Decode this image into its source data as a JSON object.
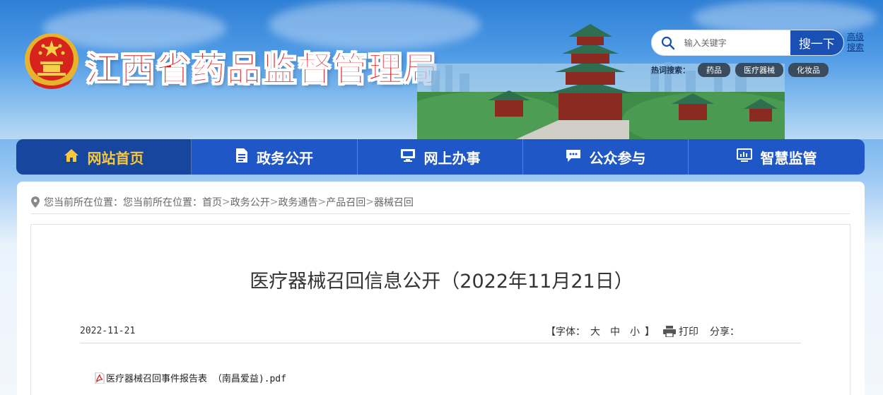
{
  "header": {
    "site_title": "江西省药品监督管理局",
    "emblem_icon": "national-emblem-icon"
  },
  "search": {
    "placeholder": "输入关键字",
    "button_label": "搜一下",
    "advanced_label": "高级搜索",
    "hot_label": "热词搜索：",
    "hot_tags": [
      "药品",
      "医疗器械",
      "化妆品"
    ]
  },
  "nav": {
    "items": [
      {
        "label": "网站首页",
        "icon": "home-icon",
        "active": true
      },
      {
        "label": "政务公开",
        "icon": "document-icon"
      },
      {
        "label": "网上办事",
        "icon": "monitor-icon"
      },
      {
        "label": "公众参与",
        "icon": "chat-icon"
      },
      {
        "label": "智慧监管",
        "icon": "chart-screen-icon"
      }
    ]
  },
  "breadcrumb": {
    "prefix": "您当前所在位置：",
    "prefix2": "您当前所在位置：",
    "items": [
      "首页",
      "政务公开",
      "政务通告",
      "产品召回",
      "器械召回"
    ],
    "separator": ">"
  },
  "article": {
    "title": "医疗器械召回信息公开（2022年11月21日）",
    "date": "2022-11-21",
    "font_label": "【字体：",
    "font_sizes": [
      "大",
      "中",
      "小"
    ],
    "font_close": "】",
    "print_label": "打印",
    "share_label": "分享：",
    "attachment": "医疗器械召回事件报告表 （南昌爱益).pdf"
  },
  "colors": {
    "title_red": "#d71a1b",
    "nav_blue": "#1f57c6",
    "nav_active_text": "#f5c842",
    "search_button": "#1a4fb3"
  }
}
